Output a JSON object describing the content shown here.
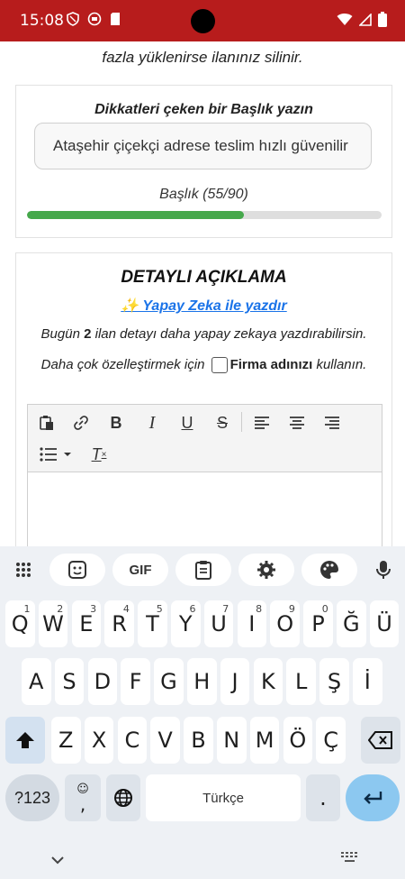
{
  "status_bar": {
    "time": "15:08"
  },
  "notice": "fazla yüklenirse ilanınız silinir.",
  "title_card": {
    "label": "Dikkatleri çeken bir Başlık yazın",
    "input_value": "Ataşehir çiçekçi adrese teslim hızlı güvenilir",
    "counter": "Başlık (55/90)",
    "progress_fraction": 0.611
  },
  "desc_card": {
    "title": "DETAYLI AÇIKLAMA",
    "ai_link": "✨ Yapay Zeka ile yazdır",
    "text_pre": "Bugün",
    "count": "2",
    "text_mid": "ilan detayı daha yapay zekaya yazdırabilirsin. Daha çok özelleştirmek için",
    "firma": "Firma adınızı",
    "text_post": "kullanın."
  },
  "keyboard": {
    "row1": [
      "Q",
      "W",
      "E",
      "R",
      "T",
      "Y",
      "U",
      "I",
      "O",
      "P",
      "Ğ",
      "Ü"
    ],
    "row1_nums": [
      "1",
      "2",
      "3",
      "4",
      "5",
      "6",
      "7",
      "8",
      "9",
      "0"
    ],
    "row2": [
      "A",
      "S",
      "D",
      "F",
      "G",
      "H",
      "J",
      "K",
      "L",
      "Ş",
      "İ"
    ],
    "row3": [
      "Z",
      "X",
      "C",
      "V",
      "B",
      "N",
      "M",
      "Ö",
      "Ç"
    ],
    "symbols_label": "?123",
    "comma": ",",
    "space_label": "Türkçe",
    "period": ".",
    "gif_label": "GIF"
  },
  "colors": {
    "status_bar": "#b71c1c",
    "progress": "#45a84b",
    "link": "#1a73e8",
    "enter_key": "#8cc8f0"
  }
}
